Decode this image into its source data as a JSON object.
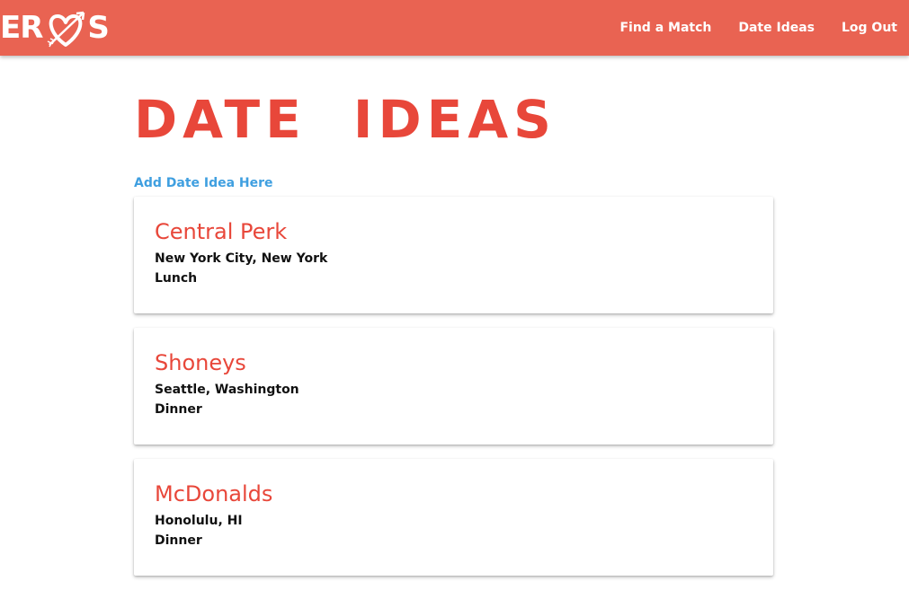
{
  "colors": {
    "navbar_bg": "#e96352",
    "brand_red": "#e8473a",
    "link_blue": "#3f9fe0",
    "white": "#ffffff"
  },
  "brand": {
    "logo_left": "ER",
    "logo_icon": "heart-arrow-icon",
    "logo_right": "S"
  },
  "nav": {
    "items": [
      {
        "label": "Find a Match"
      },
      {
        "label": "Date Ideas"
      },
      {
        "label": "Log Out"
      }
    ]
  },
  "page": {
    "title": "DATE IDEAS",
    "add_link": "Add Date Idea Here"
  },
  "date_ideas": [
    {
      "name": "Central Perk",
      "location": "New York City, New York",
      "meal": "Lunch"
    },
    {
      "name": "Shoneys",
      "location": "Seattle, Washington",
      "meal": "Dinner"
    },
    {
      "name": "McDonalds",
      "location": "Honolulu, HI",
      "meal": "Dinner"
    }
  ]
}
